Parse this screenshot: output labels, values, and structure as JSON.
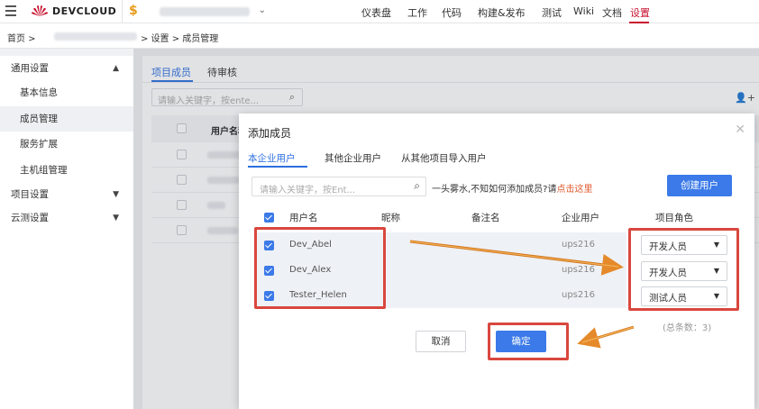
{
  "brand": {
    "logo_text": "DEVCLOUD",
    "currency_symbol": "$"
  },
  "nav": {
    "items": [
      {
        "label": "仪表盘",
        "active": false
      },
      {
        "label": "工作",
        "active": false
      },
      {
        "label": "代码",
        "active": false
      },
      {
        "label": "构建&发布",
        "active": false
      },
      {
        "label": "测试",
        "active": false
      },
      {
        "label": "Wiki",
        "active": false
      },
      {
        "label": "文档",
        "active": false
      },
      {
        "label": "设置",
        "active": true
      }
    ]
  },
  "breadcrumb": {
    "home": "首页 >",
    "rest": "> 设置 > 成员管理"
  },
  "sidebar": {
    "items": [
      {
        "label": "通用设置",
        "level": "top",
        "chevron": "▲"
      },
      {
        "label": "基本信息",
        "level": "sub"
      },
      {
        "label": "成员管理",
        "level": "sub",
        "selected": true
      },
      {
        "label": "服务扩展",
        "level": "sub"
      },
      {
        "label": "主机组管理",
        "level": "sub"
      },
      {
        "label": "项目设置",
        "level": "top",
        "chevron": "▼"
      },
      {
        "label": "云测设置",
        "level": "top",
        "chevron": "▼"
      }
    ]
  },
  "page": {
    "tabs": [
      {
        "label": "项目成员",
        "active": true
      },
      {
        "label": "待审核",
        "active": false
      }
    ],
    "search_placeholder": "请输入关键字，按ente...",
    "table_header_user": "用户名称"
  },
  "modal": {
    "title": "添加成员",
    "tabs": [
      {
        "label": "本企业用户",
        "active": true
      },
      {
        "label": "其他企业用户",
        "active": false
      },
      {
        "label": "从其他项目导入用户",
        "active": false
      }
    ],
    "search_placeholder": "请输入关键字，按Ent...",
    "hint_text": "一头雾水,不知如何添加成员?请",
    "hint_link": "点击这里",
    "create_button": "创建用户",
    "columns": {
      "username": "用户名",
      "nickname": "昵称",
      "remark": "备注名",
      "enterprise_user": "企业用户",
      "project_role": "项目角色"
    },
    "rows": [
      {
        "username": "Dev_Abel",
        "nickname": "",
        "remark": "",
        "enterprise_user": "ups216",
        "role": "开发人员",
        "checked": true
      },
      {
        "username": "Dev_Alex",
        "nickname": "",
        "remark": "",
        "enterprise_user": "ups216",
        "role": "开发人员",
        "checked": true
      },
      {
        "username": "Tester_Helen",
        "nickname": "",
        "remark": "",
        "enterprise_user": "ups216",
        "role": "测试人员",
        "checked": true
      }
    ],
    "total_text": "(总条数：3)",
    "cancel_button": "取消",
    "confirm_button": "确定"
  },
  "colors": {
    "accent": "#3b7ae8",
    "nav_active": "#c8102e",
    "highlight": "#d9473e",
    "arrow": "#e58a2a"
  },
  "icons": [
    "hamburger-icon",
    "logo-icon",
    "chevron-down-icon",
    "search-icon",
    "add-user-icon",
    "close-icon",
    "checkbox-icon",
    "arrow-annotation"
  ]
}
